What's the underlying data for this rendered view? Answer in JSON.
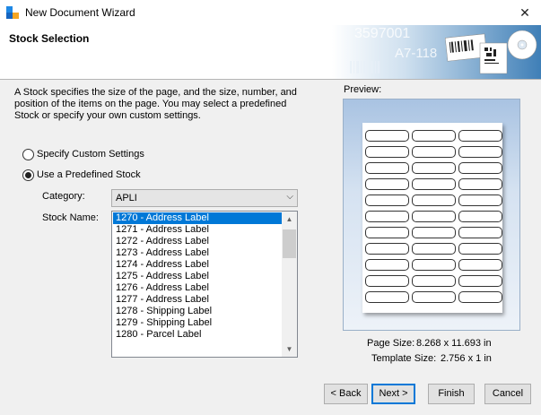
{
  "window": {
    "title": "New Document Wizard",
    "close_glyph": "✕"
  },
  "banner": {
    "title": "Stock Selection",
    "art_text_1": "3597001",
    "art_text_2": "A7-118"
  },
  "description": "A Stock specifies the size of the page, and the size, number, and position of the items on the page. You may select a predefined Stock or specify your own custom settings.",
  "options": {
    "custom_label": "Specify Custom Settings",
    "custom_checked": false,
    "predefined_label": "Use a Predefined Stock",
    "predefined_checked": true
  },
  "category": {
    "label": "Category:",
    "value": "APLI"
  },
  "stock": {
    "label": "Stock Name:",
    "items": [
      "1270 - Address Label",
      "1271 - Address Label",
      "1272 - Address Label",
      "1273 - Address Label",
      "1274 - Address Label",
      "1275 - Address Label",
      "1276 - Address Label",
      "1277 - Address Label",
      "1278 - Shipping Label",
      "1279 - Shipping Label",
      "1280 - Parcel Label"
    ],
    "selected_index": 0
  },
  "preview": {
    "label": "Preview:",
    "rows": 11,
    "cols": 3,
    "page_size_label": "Page Size:",
    "page_size_value": "8.268 x 11.693 in",
    "template_size_label": "Template Size:",
    "template_size_value": "2.756 x 1 in"
  },
  "buttons": {
    "back": "< Back",
    "next": "Next >",
    "finish": "Finish",
    "cancel": "Cancel"
  },
  "colors": {
    "selection": "#0078d7",
    "app_icon_blue": "#1e88e5",
    "app_icon_orange": "#f5a623"
  }
}
